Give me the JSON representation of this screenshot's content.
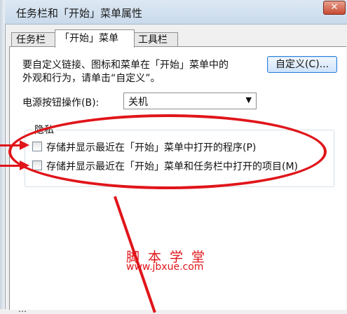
{
  "window": {
    "title": "任务栏和「开始」菜单属性",
    "close_label": "✕"
  },
  "tabs": [
    {
      "label": "任务栏"
    },
    {
      "label": "「开始」菜单"
    },
    {
      "label": "工具栏"
    }
  ],
  "start_menu": {
    "description_line1": "要自定义链接、图标和菜单在「开始」菜单中的",
    "description_line2": "外观和行为，请单击“自定义”。",
    "customize_button": "自定义(C)...",
    "power_button_label": "电源按钮操作(B):",
    "power_button_value": "关机",
    "privacy": {
      "title": "隐私",
      "option1": "存储并显示最近在「开始」菜单中打开的程序(P)",
      "option2": "存储并显示最近在「开始」菜单和任务栏中打开的项目(M)"
    }
  },
  "annotations": {
    "highlight_color": "#e0151a"
  },
  "watermark": {
    "name": "脚本学堂",
    "url": "www.jbxue.com"
  },
  "bottom_fragment": "…"
}
